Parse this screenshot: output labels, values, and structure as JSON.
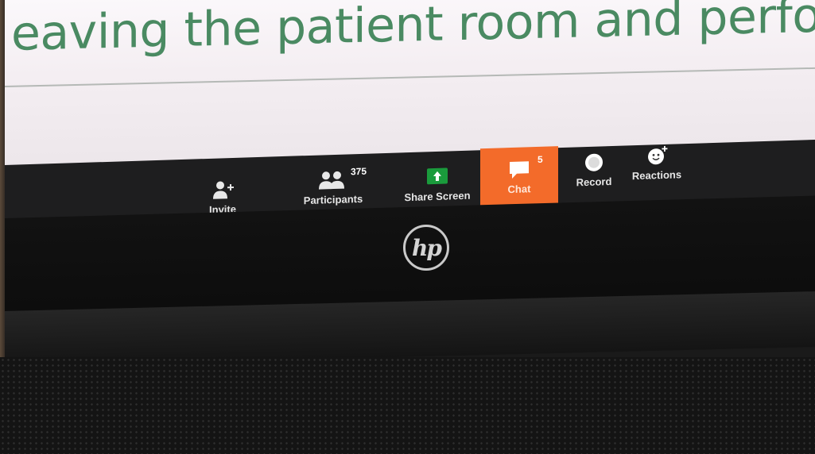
{
  "slide": {
    "text": "eaving the patient room and perform"
  },
  "toolbar": {
    "invite_label": "Invite",
    "participants_label": "Participants",
    "participants_count": "375",
    "share_screen_label": "Share Screen",
    "chat_label": "Chat",
    "chat_badge": "5",
    "record_label": "Record",
    "reactions_label": "Reactions"
  },
  "laptop": {
    "logo_text": "hp"
  },
  "colors": {
    "slide_text": "#4a8a62",
    "toolbar_bg": "#1e1e1f",
    "chat_highlight": "#f36b2a",
    "share_green": "#1a9b3c"
  }
}
